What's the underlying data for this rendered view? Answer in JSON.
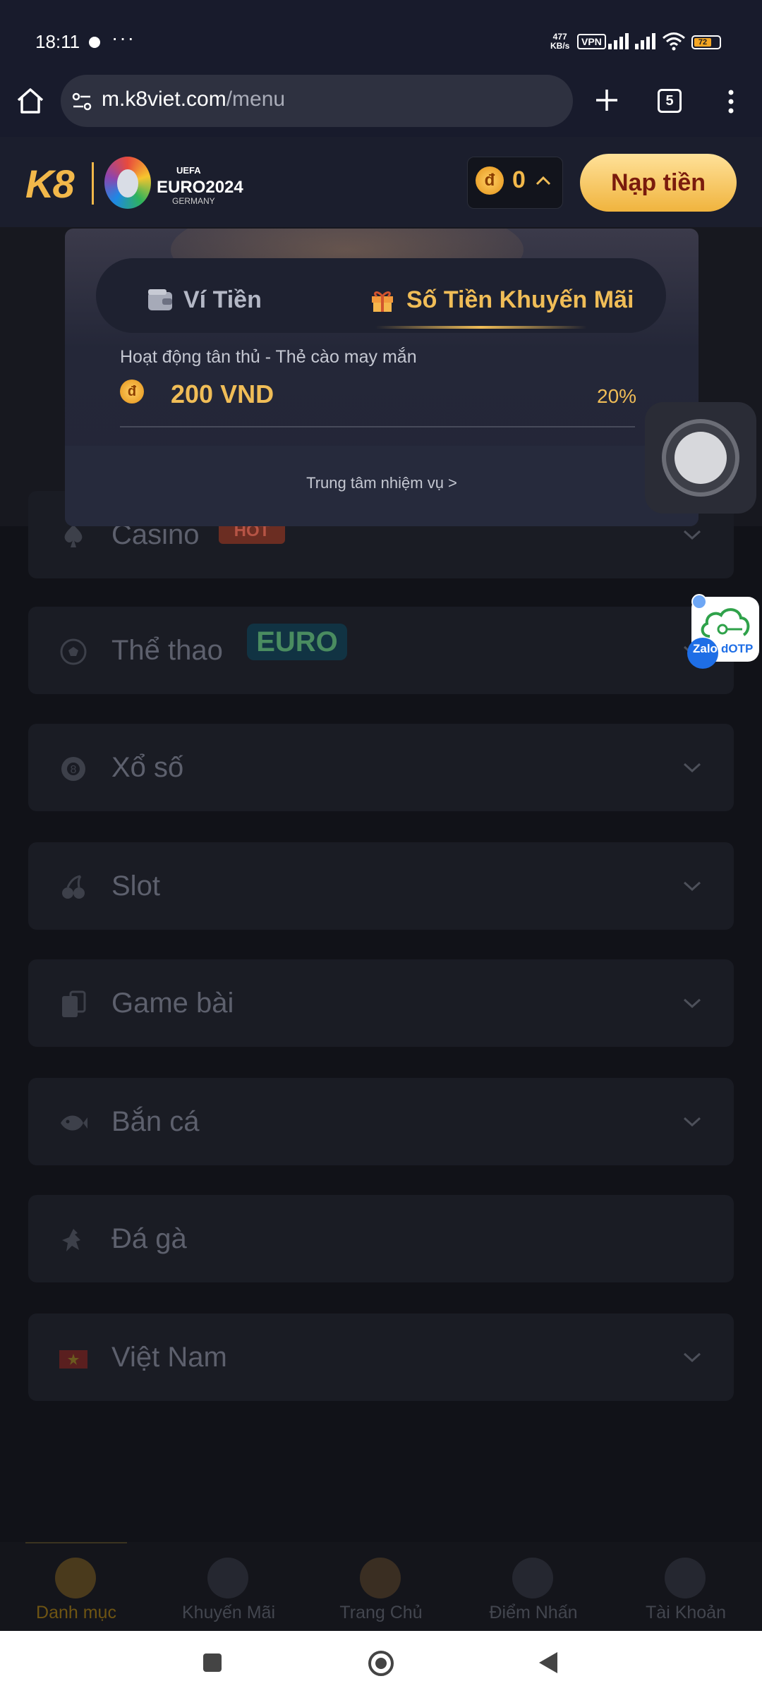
{
  "status_bar": {
    "time": "18:11",
    "more": "···",
    "net_speed_value": "477",
    "net_speed_unit": "KB/s",
    "vpn": "VPN",
    "battery": "72"
  },
  "browser": {
    "url_host": "m.k8viet.com",
    "url_path": "/menu",
    "tab_count": "5"
  },
  "header": {
    "logo_text": "K8",
    "euro_uefa": "UEFA",
    "euro_title": "EURO2024",
    "euro_sub": "GERMANY",
    "currency_symbol": "đ",
    "balance": "0",
    "deposit_label": "Nạp tiền",
    "accent_color": "#f0bd57"
  },
  "popup": {
    "tabs": [
      {
        "label": "Ví Tiền",
        "icon": "wallet-icon",
        "active": false
      },
      {
        "label": "Số Tiền Khuyến Mãi",
        "icon": "gift-icon",
        "active": true
      }
    ],
    "promo_title": "Hoạt động tân thủ - Thẻ cào may mắn",
    "promo_amount": "200 VND",
    "promo_percent": "20%",
    "mission_link": "Trung tâm nhiệm vụ >"
  },
  "menu": {
    "casino_badge": "HOT",
    "euro_badge": "EURO",
    "items": [
      {
        "label": "Casino",
        "icon": "spade-icon"
      },
      {
        "label": "Thể thao",
        "icon": "soccer-ball-icon"
      },
      {
        "label": "Xổ số",
        "icon": "lottery-ball-icon"
      },
      {
        "label": "Slot",
        "icon": "cherry-icon"
      },
      {
        "label": "Game bài",
        "icon": "cards-icon"
      },
      {
        "label": "Bắn cá",
        "icon": "fish-icon"
      },
      {
        "label": "Đá gà",
        "icon": "rooster-icon"
      },
      {
        "label": "Việt Nam",
        "icon": "vietnam-flag-icon"
      }
    ]
  },
  "zalo": {
    "label": "Zalo",
    "otp": "dOTP"
  },
  "bottom_nav": [
    {
      "label": "Danh mục",
      "icon": "shoe-icon"
    },
    {
      "label": "Khuyến Mãi",
      "icon": "whistle-icon"
    },
    {
      "label": "Trang Chủ",
      "icon": "mascot-icon"
    },
    {
      "label": "Điểm Nhấn",
      "icon": "referee-icon"
    },
    {
      "label": "Tài Khoản",
      "icon": "jersey-icon"
    }
  ]
}
